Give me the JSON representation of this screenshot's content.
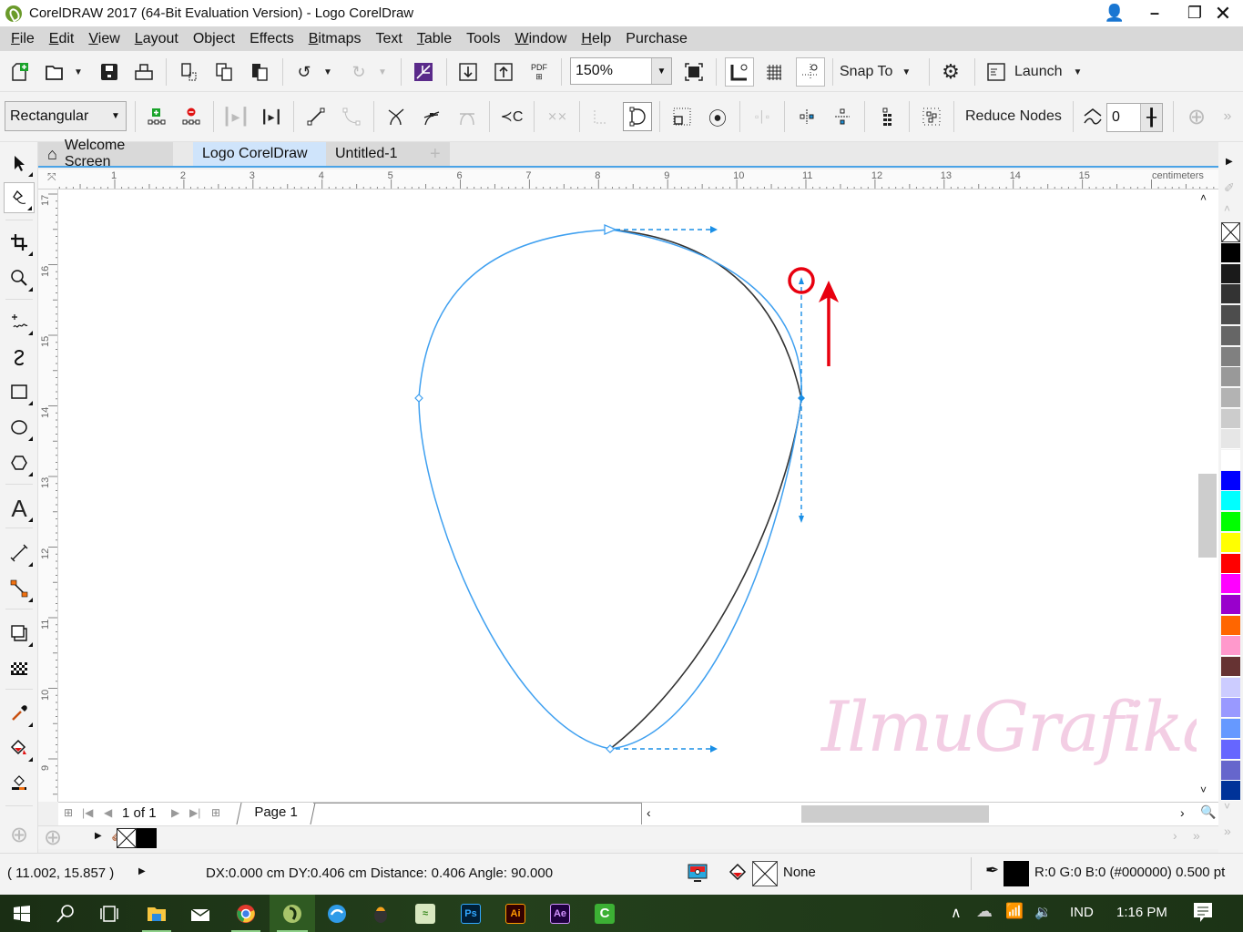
{
  "titlebar": {
    "title": "CorelDRAW 2017 (64-Bit Evaluation Version) - Logo CorelDraw",
    "minimize": "minimize",
    "restore": "restore",
    "close": "close"
  },
  "menu": [
    {
      "label": "File",
      "u": "F",
      "rest": "ile"
    },
    {
      "label": "Edit",
      "u": "E",
      "rest": "dit"
    },
    {
      "label": "View",
      "u": "V",
      "rest": "iew"
    },
    {
      "label": "Layout",
      "u": "L",
      "rest": "ayout"
    },
    {
      "label": "Object",
      "u": "",
      "rest": "Object"
    },
    {
      "label": "Effects",
      "u": "",
      "rest": "Effects"
    },
    {
      "label": "Bitmaps",
      "u": "B",
      "rest": "itmaps"
    },
    {
      "label": "Text",
      "u": "",
      "rest": "Text"
    },
    {
      "label": "Table",
      "u": "T",
      "rest": "able"
    },
    {
      "label": "Tools",
      "u": "",
      "rest": "Tools"
    },
    {
      "label": "Window",
      "u": "W",
      "rest": "indow"
    },
    {
      "label": "Help",
      "u": "H",
      "rest": "elp"
    },
    {
      "label": "Purchase",
      "u": "",
      "rest": "Purchase"
    }
  ],
  "toolbar": {
    "zoom_level": "150%",
    "snap_to": "Snap To",
    "launch": "Launch"
  },
  "property_bar": {
    "selection_mode": "Rectangular",
    "reduce_nodes": "Reduce Nodes",
    "curve_smoothness": "0"
  },
  "doc_tabs": [
    {
      "label": "Welcome Screen",
      "active": false
    },
    {
      "label": "Logo CorelDraw",
      "active": true
    },
    {
      "label": "Untitled-1",
      "active": false
    }
  ],
  "ruler": {
    "h_labels": [
      "1",
      "2",
      "3",
      "4",
      "5",
      "6",
      "7",
      "8",
      "9",
      "10",
      "11",
      "12",
      "13",
      "14",
      "15"
    ],
    "units": "centimeters",
    "v_labels": [
      "17",
      "16",
      "15",
      "14",
      "13",
      "12",
      "11",
      "10",
      "9"
    ]
  },
  "toolbox": [
    "pick-tool",
    "shape-tool",
    "crop-tool",
    "zoom-tool",
    "freehand-tool",
    "artistic-media-tool",
    "rectangle-tool",
    "ellipse-tool",
    "polygon-tool",
    "text-tool",
    "parallel-dimension-tool",
    "connector-tool",
    "drop-shadow-tool",
    "transparency-tool",
    "color-eyedropper-tool",
    "interactive-fill-tool",
    "smart-fill-tool"
  ],
  "palette": {
    "colors": [
      "#000000",
      "#1a1a1a",
      "#333333",
      "#4d4d4d",
      "#666666",
      "#808080",
      "#999999",
      "#b3b3b3",
      "#cccccc",
      "#e6e6e6",
      "#ffffff",
      "#0000ff",
      "#00ffff",
      "#00ff00",
      "#ffff00",
      "#ff0000",
      "#ff00ff",
      "#9900cc",
      "#ff6600",
      "#ff99cc",
      "#663333",
      "#ccccff",
      "#9999ff",
      "#6699ff",
      "#6666ff",
      "#6666cc",
      "#003399"
    ]
  },
  "page_nav": {
    "current": "1",
    "of": "of",
    "total": "1",
    "page_tab": "Page 1"
  },
  "watermark": "IlmuGrafika.id",
  "status": {
    "coords": "( 11.002, 15.857 )",
    "delta": "DX:0.000 cm DY:0.406 cm Distance: 0.406 Angle: 90.000",
    "fill": "None",
    "outline": "R:0 G:0 B:0 (#000000)  0.500 pt"
  },
  "taskbar": {
    "apps": [
      "start",
      "search",
      "task-view",
      "file-explorer",
      "mail",
      "chrome",
      "coreldraw",
      "app-blue",
      "fl-studio",
      "app-green",
      "photoshop",
      "illustrator",
      "after-effects",
      "camtasia"
    ],
    "ps": "Ps",
    "ai": "Ai",
    "ae": "Ae",
    "cm": "C",
    "lang": "IND",
    "time": "1:16 PM"
  },
  "colors": {
    "accent": "#4aa3e6",
    "curve_blue": "#3fa0f0",
    "annotation_red": "#e8000f"
  }
}
